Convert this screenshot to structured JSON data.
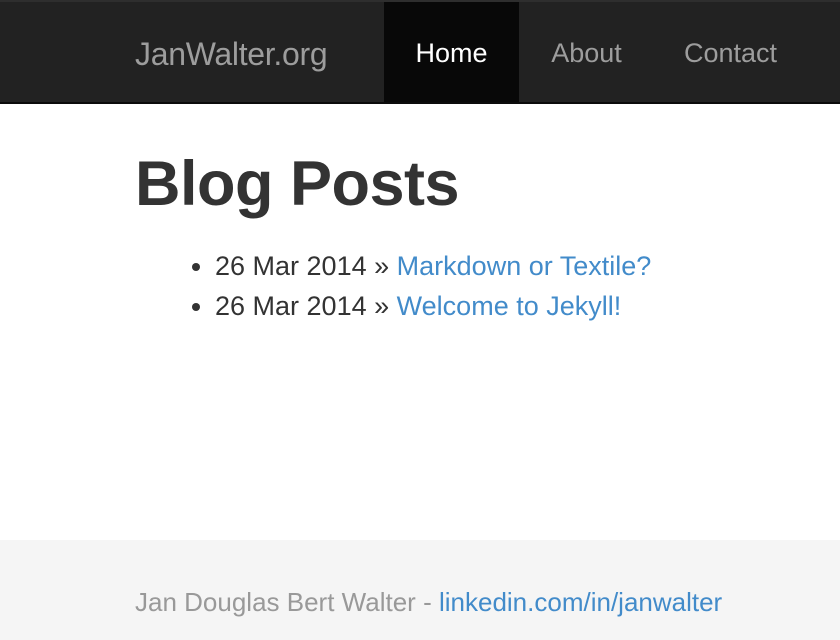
{
  "navbar": {
    "brand": "JanWalter.org",
    "items": [
      {
        "label": "Home",
        "active": true
      },
      {
        "label": "About",
        "active": false
      },
      {
        "label": "Contact",
        "active": false
      }
    ]
  },
  "main": {
    "title": "Blog Posts",
    "posts": [
      {
        "date": "26 Mar 2014",
        "separator": "»",
        "title": "Markdown or Textile?"
      },
      {
        "date": "26 Mar 2014",
        "separator": "»",
        "title": "Welcome to Jekyll!"
      }
    ]
  },
  "footer": {
    "author": "Jan Douglas Bert Walter",
    "dash": "-",
    "link_text": "linkedin.com/in/janwalter"
  },
  "colors": {
    "navbar_bg": "#222222",
    "active_bg": "#080808",
    "link": "#428bca",
    "footer_bg": "#f5f5f5"
  }
}
